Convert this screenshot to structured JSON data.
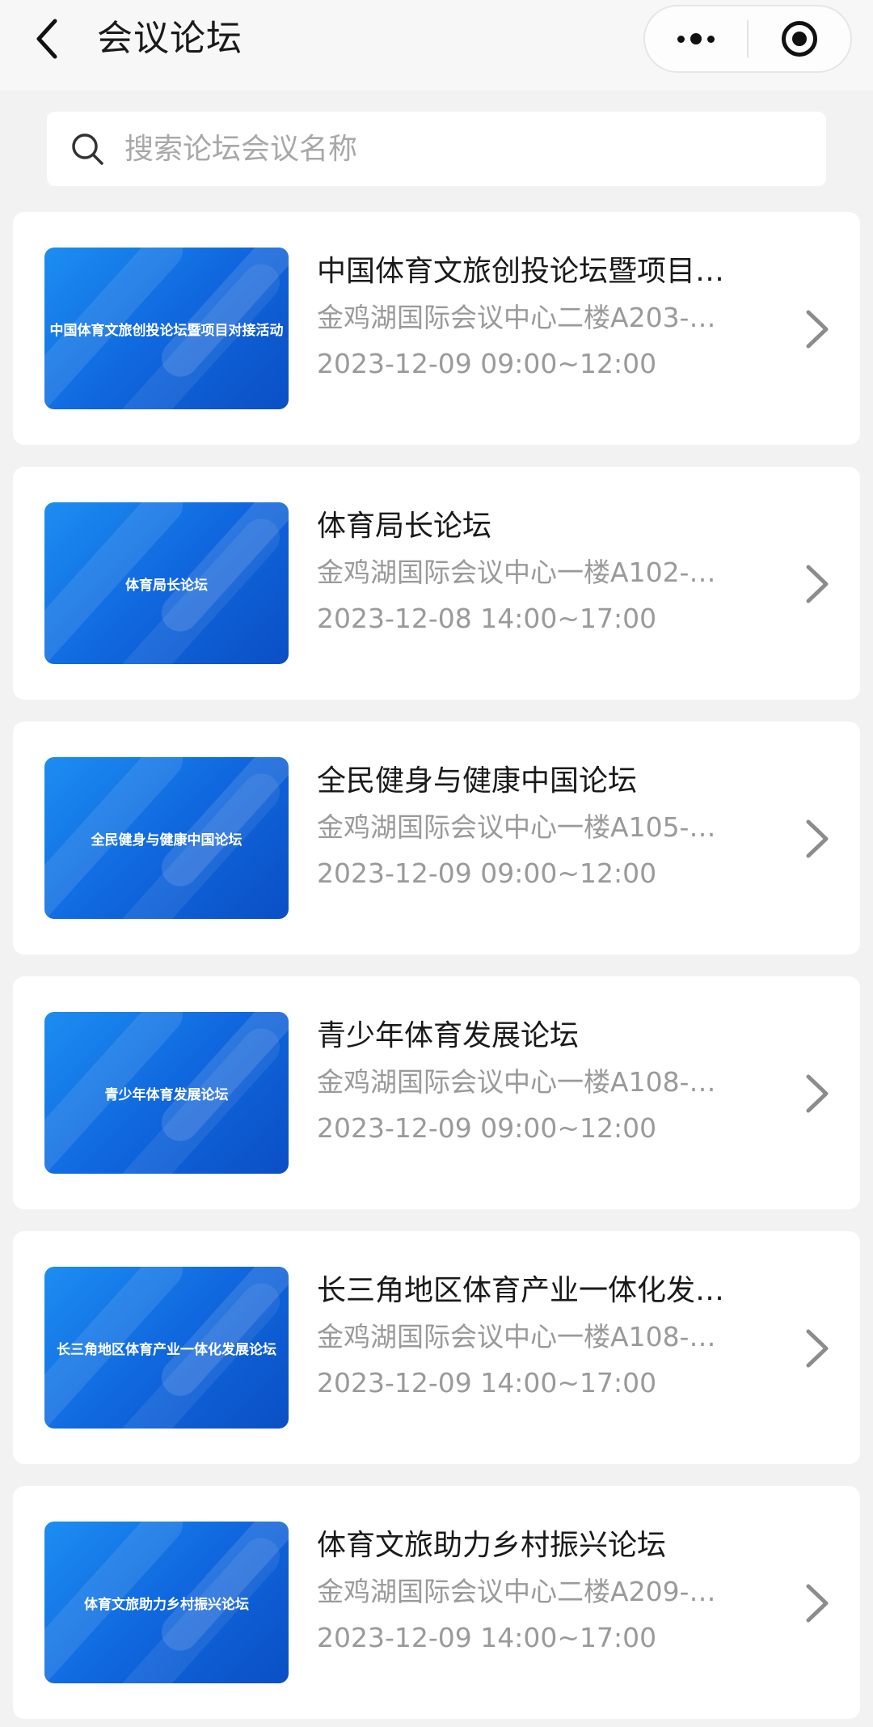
{
  "nav": {
    "title": "会议论坛",
    "back_icon": "chevron-left-icon",
    "more_icon": "more-dots-icon",
    "close_icon": "target-circle-icon"
  },
  "search": {
    "placeholder": "搜索论坛会议名称",
    "value": "",
    "icon": "search-icon"
  },
  "forums": [
    {
      "thumb_text": "中国体育文旅创投论坛暨项目对接活动",
      "title": "中国体育文旅创投论坛暨项目…",
      "location": "金鸡湖国际会议中心二楼A203-…",
      "time": "2023-12-09 09:00~12:00"
    },
    {
      "thumb_text": "体育局长论坛",
      "title": "体育局长论坛",
      "location": "金鸡湖国际会议中心一楼A102-…",
      "time": "2023-12-08 14:00~17:00"
    },
    {
      "thumb_text": "全民健身与健康中国论坛",
      "title": "全民健身与健康中国论坛",
      "location": "金鸡湖国际会议中心一楼A105-…",
      "time": "2023-12-09 09:00~12:00"
    },
    {
      "thumb_text": "青少年体育发展论坛",
      "title": "青少年体育发展论坛",
      "location": "金鸡湖国际会议中心一楼A108-…",
      "time": "2023-12-09 09:00~12:00"
    },
    {
      "thumb_text": "长三角地区体育产业一体化发展论坛",
      "title": "长三角地区体育产业一体化发…",
      "location": "金鸡湖国际会议中心一楼A108-…",
      "time": "2023-12-09 14:00~17:00"
    },
    {
      "thumb_text": "体育文旅助力乡村振兴论坛",
      "title": "体育文旅助力乡村振兴论坛",
      "location": "金鸡湖国际会议中心二楼A209-…",
      "time": "2023-12-09 14:00~17:00"
    }
  ],
  "colors": {
    "thumb_start": "#1c8ef2",
    "thumb_end": "#0b4fc4",
    "secondary_text": "#9a9a9a",
    "background": "#f2f2f2"
  }
}
